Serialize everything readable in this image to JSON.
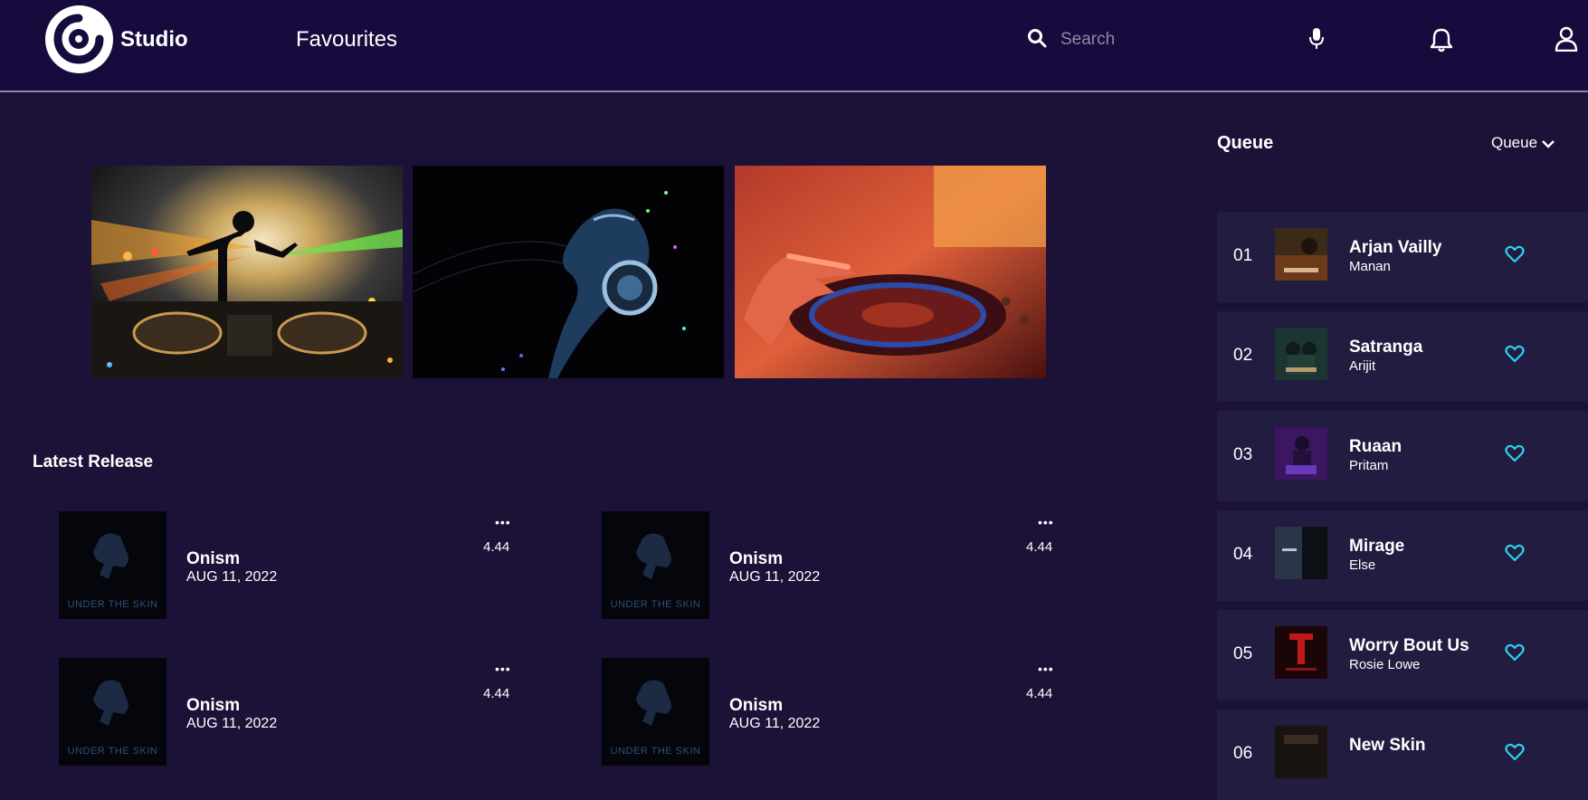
{
  "header": {
    "brand": "Studio",
    "nav_label": "Favourites",
    "search_placeholder": "Search"
  },
  "hero_images": [
    {
      "icon": "dj-silhouette-image"
    },
    {
      "icon": "headphones-face-image"
    },
    {
      "icon": "turntable-hand-image"
    }
  ],
  "latest_release": {
    "title": "Latest Release",
    "items": [
      {
        "title": "Onism",
        "date": "AUG 11, 2022",
        "duration": "4.44",
        "cover_text": "UNDER THE SKIN"
      },
      {
        "title": "Onism",
        "date": "AUG 11, 2022",
        "duration": "4.44",
        "cover_text": "UNDER THE SKIN"
      },
      {
        "title": "Onism",
        "date": "AUG 11, 2022",
        "duration": "4.44",
        "cover_text": "UNDER THE SKIN"
      },
      {
        "title": "Onism",
        "date": "AUG 11, 2022",
        "duration": "4.44",
        "cover_text": "UNDER THE SKIN"
      }
    ]
  },
  "queue": {
    "title": "Queue",
    "dropdown_label": "Queue",
    "items": [
      {
        "num": "01",
        "title": "Arjan Vailly",
        "artist": "Manan"
      },
      {
        "num": "02",
        "title": "Satranga",
        "artist": "Arijit"
      },
      {
        "num": "03",
        "title": "Ruaan",
        "artist": "Pritam"
      },
      {
        "num": "04",
        "title": "Mirage",
        "artist": "Else"
      },
      {
        "num": "05",
        "title": "Worry Bout Us",
        "artist": "Rosie Lowe"
      },
      {
        "num": "06",
        "title": "New Skin",
        "artist": ""
      }
    ]
  },
  "colors": {
    "header_bg": "#170b3d",
    "page_bg": "#1c1238",
    "card_bg": "#221c40",
    "heart": "#29d3f0"
  }
}
